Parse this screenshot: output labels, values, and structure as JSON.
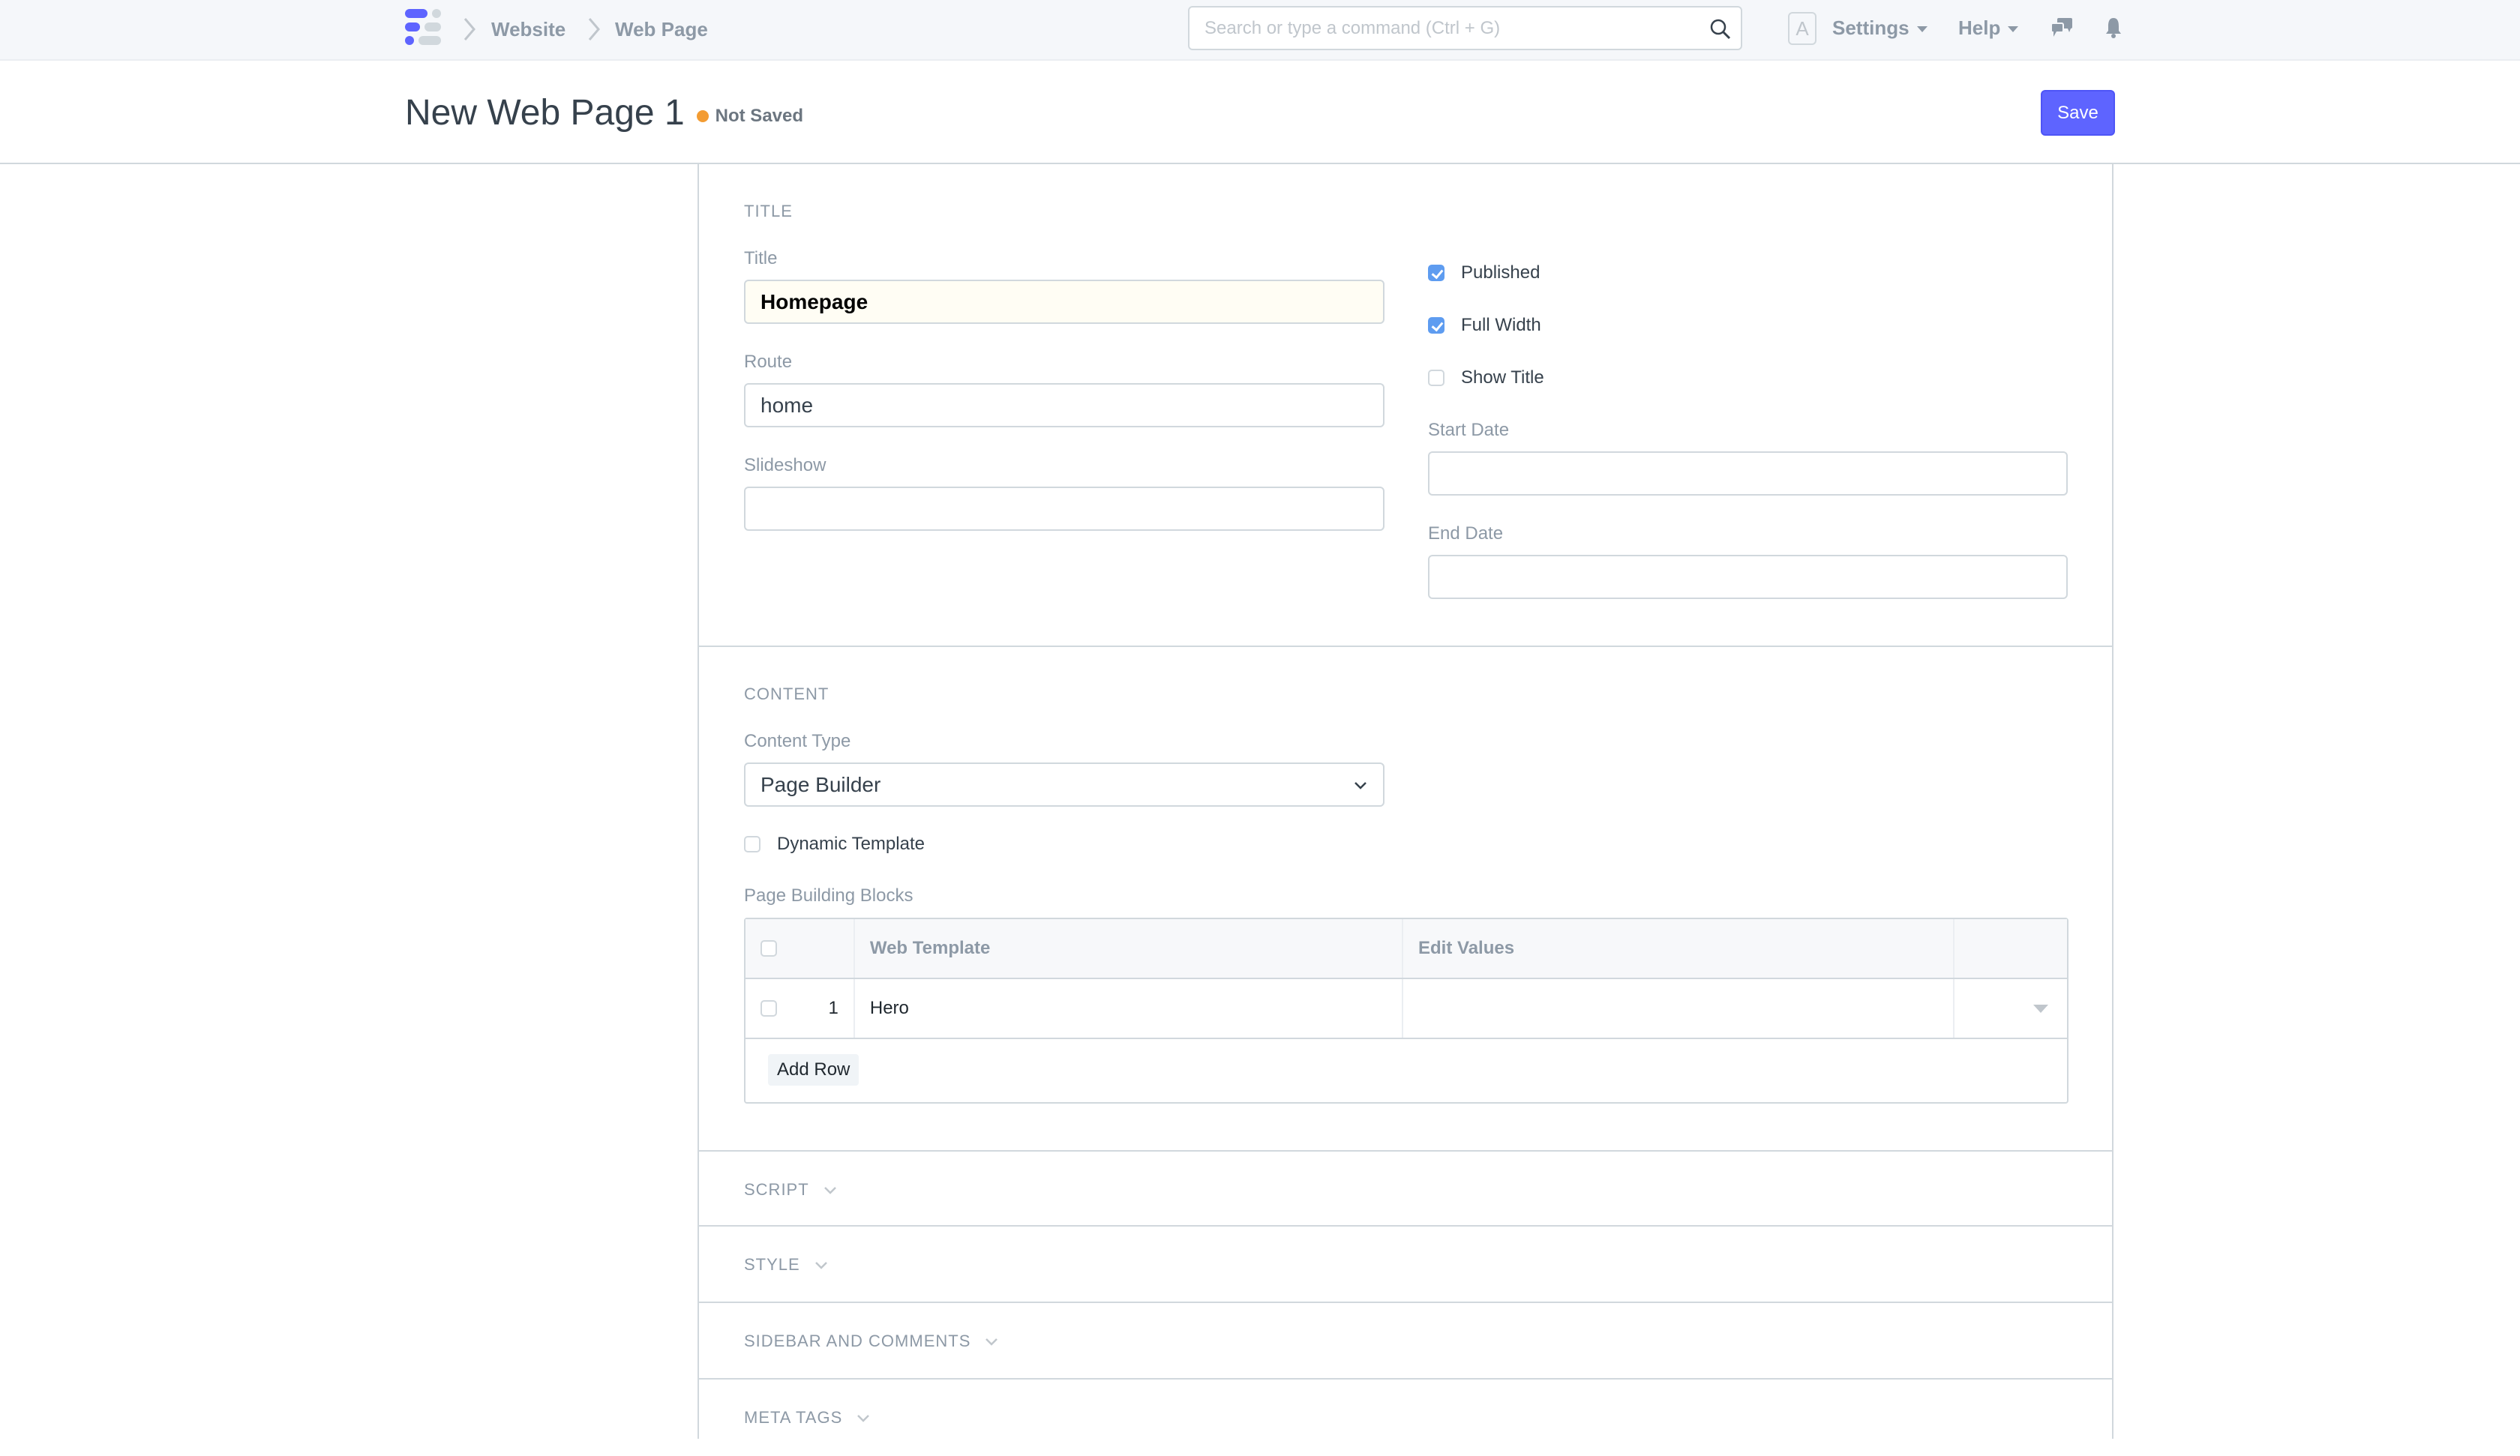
{
  "navbar": {
    "logo": "frappe-logo-icon",
    "breadcrumbs": [
      "Website",
      "Web Page"
    ],
    "search": {
      "placeholder": "Search or type a command (Ctrl + G)",
      "value": ""
    },
    "avatar_initial": "A",
    "settings_label": "Settings",
    "help_label": "Help",
    "icons": [
      "search-icon",
      "chat-icon",
      "bell-icon"
    ]
  },
  "page_head": {
    "title": "New Web Page 1",
    "indicator": "Not Saved",
    "indicator_color": "#f39c33",
    "save_label": "Save",
    "accent": "#5e64ff"
  },
  "sections": {
    "title": {
      "heading": "TITLE",
      "title_label": "Title",
      "title_value": "Homepage",
      "route_label": "Route",
      "route_value": "home",
      "slideshow_label": "Slideshow",
      "slideshow_value": "",
      "published_label": "Published",
      "published": true,
      "full_width_label": "Full Width",
      "full_width": true,
      "show_title_label": "Show Title",
      "show_title": false,
      "start_date_label": "Start Date",
      "start_date_value": "",
      "end_date_label": "End Date",
      "end_date_value": ""
    },
    "content": {
      "heading": "CONTENT",
      "content_type_label": "Content Type",
      "content_type_value": "Page Builder",
      "dynamic_template_label": "Dynamic Template",
      "dynamic_template": false,
      "blocks_label": "Page Building Blocks",
      "table": {
        "columns": [
          "",
          "Web Template",
          "Edit Values",
          ""
        ],
        "rows": [
          {
            "idx": "1",
            "web_template": "Hero",
            "edit_values": ""
          }
        ],
        "add_row_label": "Add Row"
      }
    },
    "collapsed": [
      "SCRIPT",
      "STYLE",
      "SIDEBAR AND COMMENTS",
      "META TAGS"
    ]
  }
}
